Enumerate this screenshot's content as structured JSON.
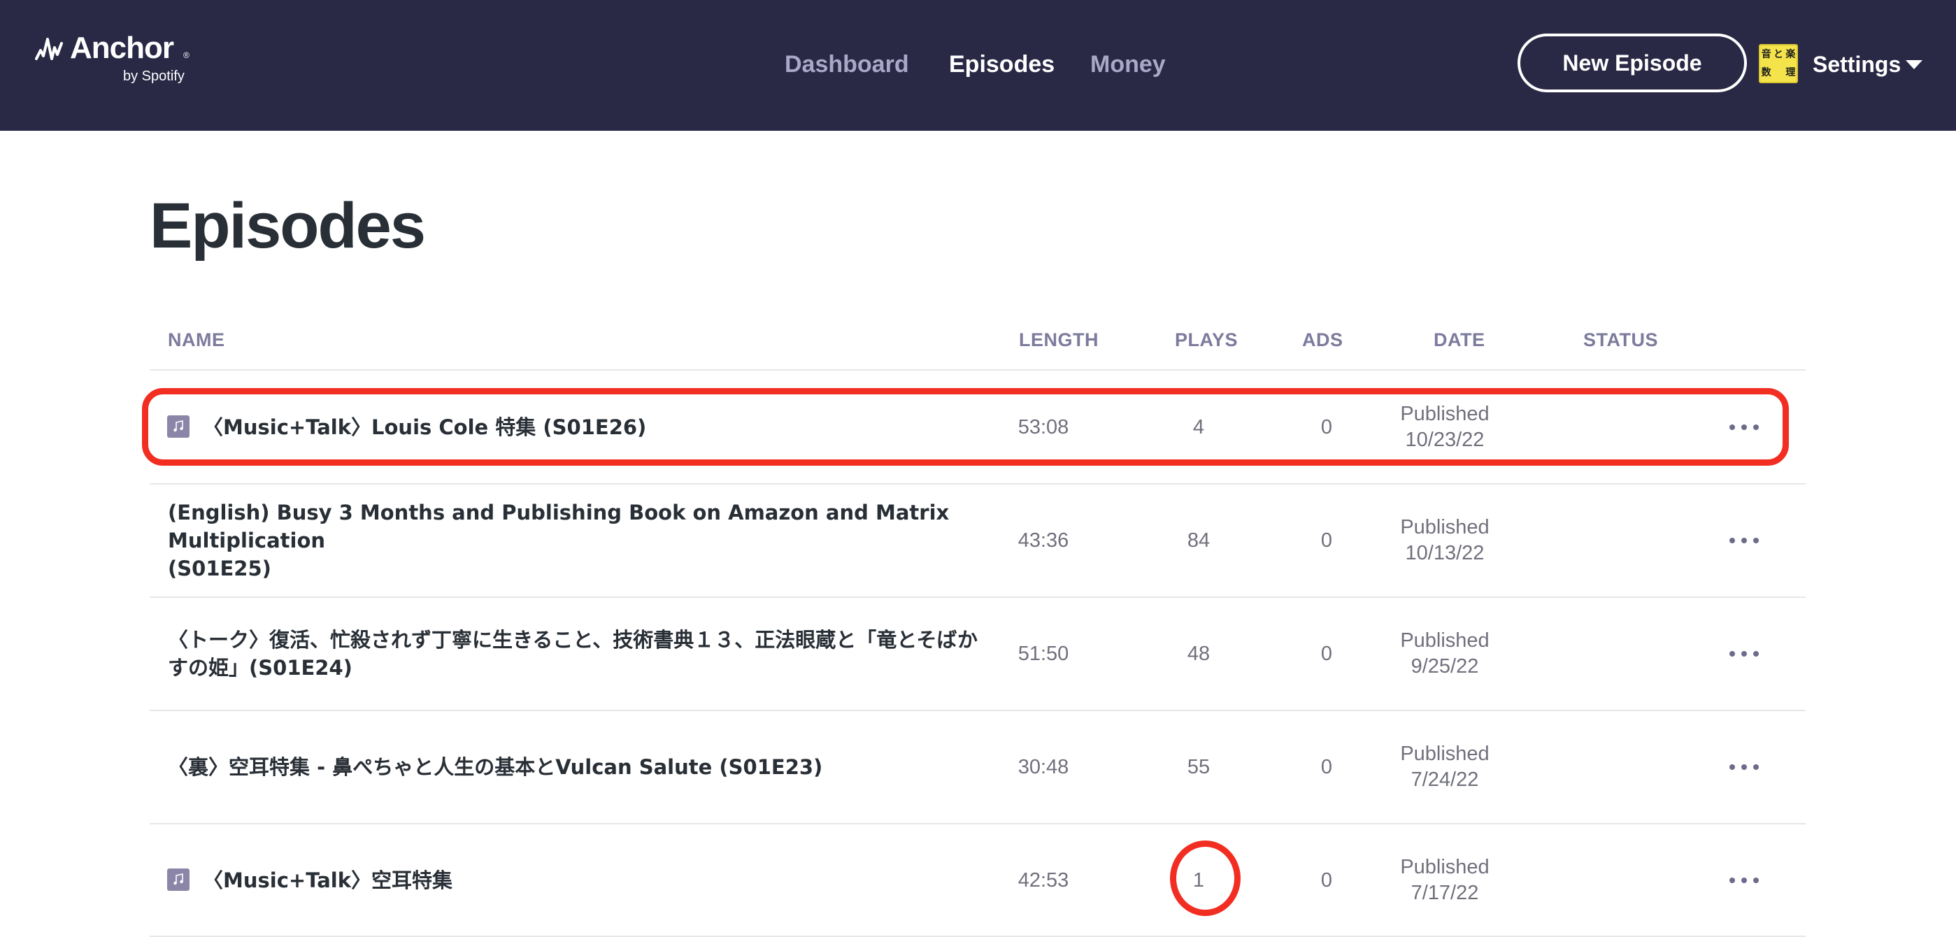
{
  "brand": {
    "name": "Anchor",
    "registered": "®",
    "sub": "by Spotify"
  },
  "nav": {
    "dashboard": "Dashboard",
    "episodes": "Episodes",
    "money": "Money"
  },
  "header": {
    "new_episode": "New Episode",
    "settings": "Settings",
    "avatar_chars": [
      "音",
      "と",
      "楽",
      "数",
      "",
      "理"
    ]
  },
  "page": {
    "title": "Episodes"
  },
  "table": {
    "columns": {
      "name": "NAME",
      "length": "LENGTH",
      "plays": "PLAYS",
      "ads": "ADS",
      "date": "DATE",
      "status": "STATUS"
    },
    "rows": [
      {
        "has_icon": true,
        "name_lines": [
          "〈Music+Talk〉Louis Cole 特集 (S01E26)"
        ],
        "length": "53:08",
        "plays": "4",
        "ads": "0",
        "date_status": "Published",
        "date": "10/23/22"
      },
      {
        "has_icon": false,
        "name_lines": [
          "(English) Busy 3 Months and Publishing Book on Amazon and Matrix Multiplication",
          "(S01E25)"
        ],
        "length": "43:36",
        "plays": "84",
        "ads": "0",
        "date_status": "Published",
        "date": "10/13/22"
      },
      {
        "has_icon": false,
        "name_lines": [
          "〈トーク〉復活、忙殺されず丁寧に生きること、技術書典１３、正法眼蔵と「竜とそばか",
          "すの姫」(S01E24)"
        ],
        "length": "51:50",
        "plays": "48",
        "ads": "0",
        "date_status": "Published",
        "date": "9/25/22"
      },
      {
        "has_icon": false,
        "name_lines": [
          "〈裏〉空耳特集 - 鼻ぺちゃと人生の基本とVulcan Salute (S01E23)"
        ],
        "length": "30:48",
        "plays": "55",
        "ads": "0",
        "date_status": "Published",
        "date": "7/24/22"
      },
      {
        "has_icon": true,
        "name_lines": [
          "〈Music+Talk〉空耳特集"
        ],
        "length": "42:53",
        "plays": "1",
        "ads": "0",
        "date_status": "Published",
        "date": "7/17/22"
      }
    ]
  },
  "colors": {
    "nav_bg": "#292845",
    "accent_red": "#f22d21",
    "header_text": "#7c7b9c",
    "cell_text": "#70707d"
  }
}
